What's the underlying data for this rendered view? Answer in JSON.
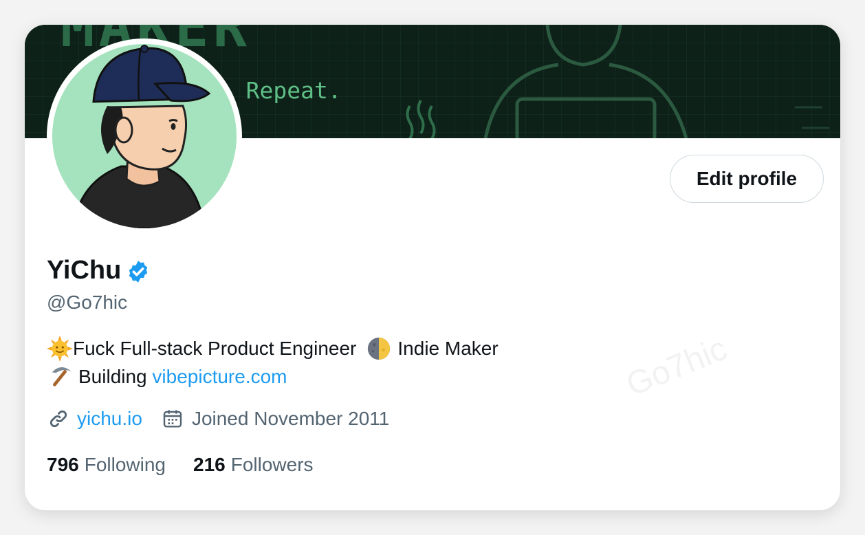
{
  "banner": {
    "headline": "MAKER",
    "tagline": "h. Repeat."
  },
  "profile": {
    "display_name": "YiChu",
    "handle": "@Go7hic",
    "edit_button_label": "Edit profile",
    "verified_color": "#1d9bf0",
    "accent_color": "#1d9bf0"
  },
  "bio": {
    "line1_text": "Fuck Full-stack Product Engineer",
    "line1_tail": "Indie Maker",
    "line2_text": "Building",
    "line2_link": "vibepicture.com"
  },
  "meta": {
    "website": "yichu.io",
    "joined": "Joined November 2011"
  },
  "stats": {
    "following_count": "796",
    "following_label": "Following",
    "followers_count": "216",
    "followers_label": "Followers"
  },
  "watermark": "Go7hic"
}
